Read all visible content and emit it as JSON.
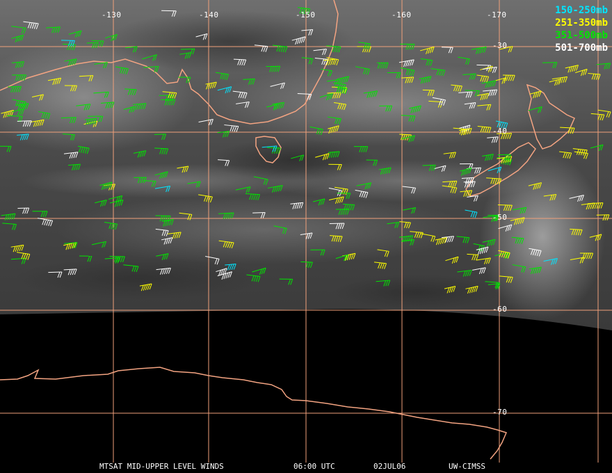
{
  "colors": {
    "grid": "#f0a07a",
    "coast": "#f4a482",
    "cyan": "#00e5ff",
    "yellow": "#ffff00",
    "green": "#00e600",
    "white": "#ffffff",
    "space": "#000000"
  },
  "legend": [
    {
      "label": "150-250mb",
      "color": "#00e5ff"
    },
    {
      "label": "251-350mb",
      "color": "#ffff00"
    },
    {
      "label": "351-500mb",
      "color": "#00e600"
    },
    {
      "label": "501-700mb",
      "color": "#ffffff"
    }
  ],
  "longitude_labels": [
    "-130",
    "-140",
    "-150",
    "-160",
    "-170"
  ],
  "latitude_labels": [
    "-30",
    "-40",
    "-50",
    "-60",
    "-70"
  ],
  "footer": {
    "title": "MTSAT MID-UPPER LEVEL WINDS",
    "time": "06:00 UTC",
    "date": "02JUL06",
    "source": "UW-CIMSS"
  }
}
